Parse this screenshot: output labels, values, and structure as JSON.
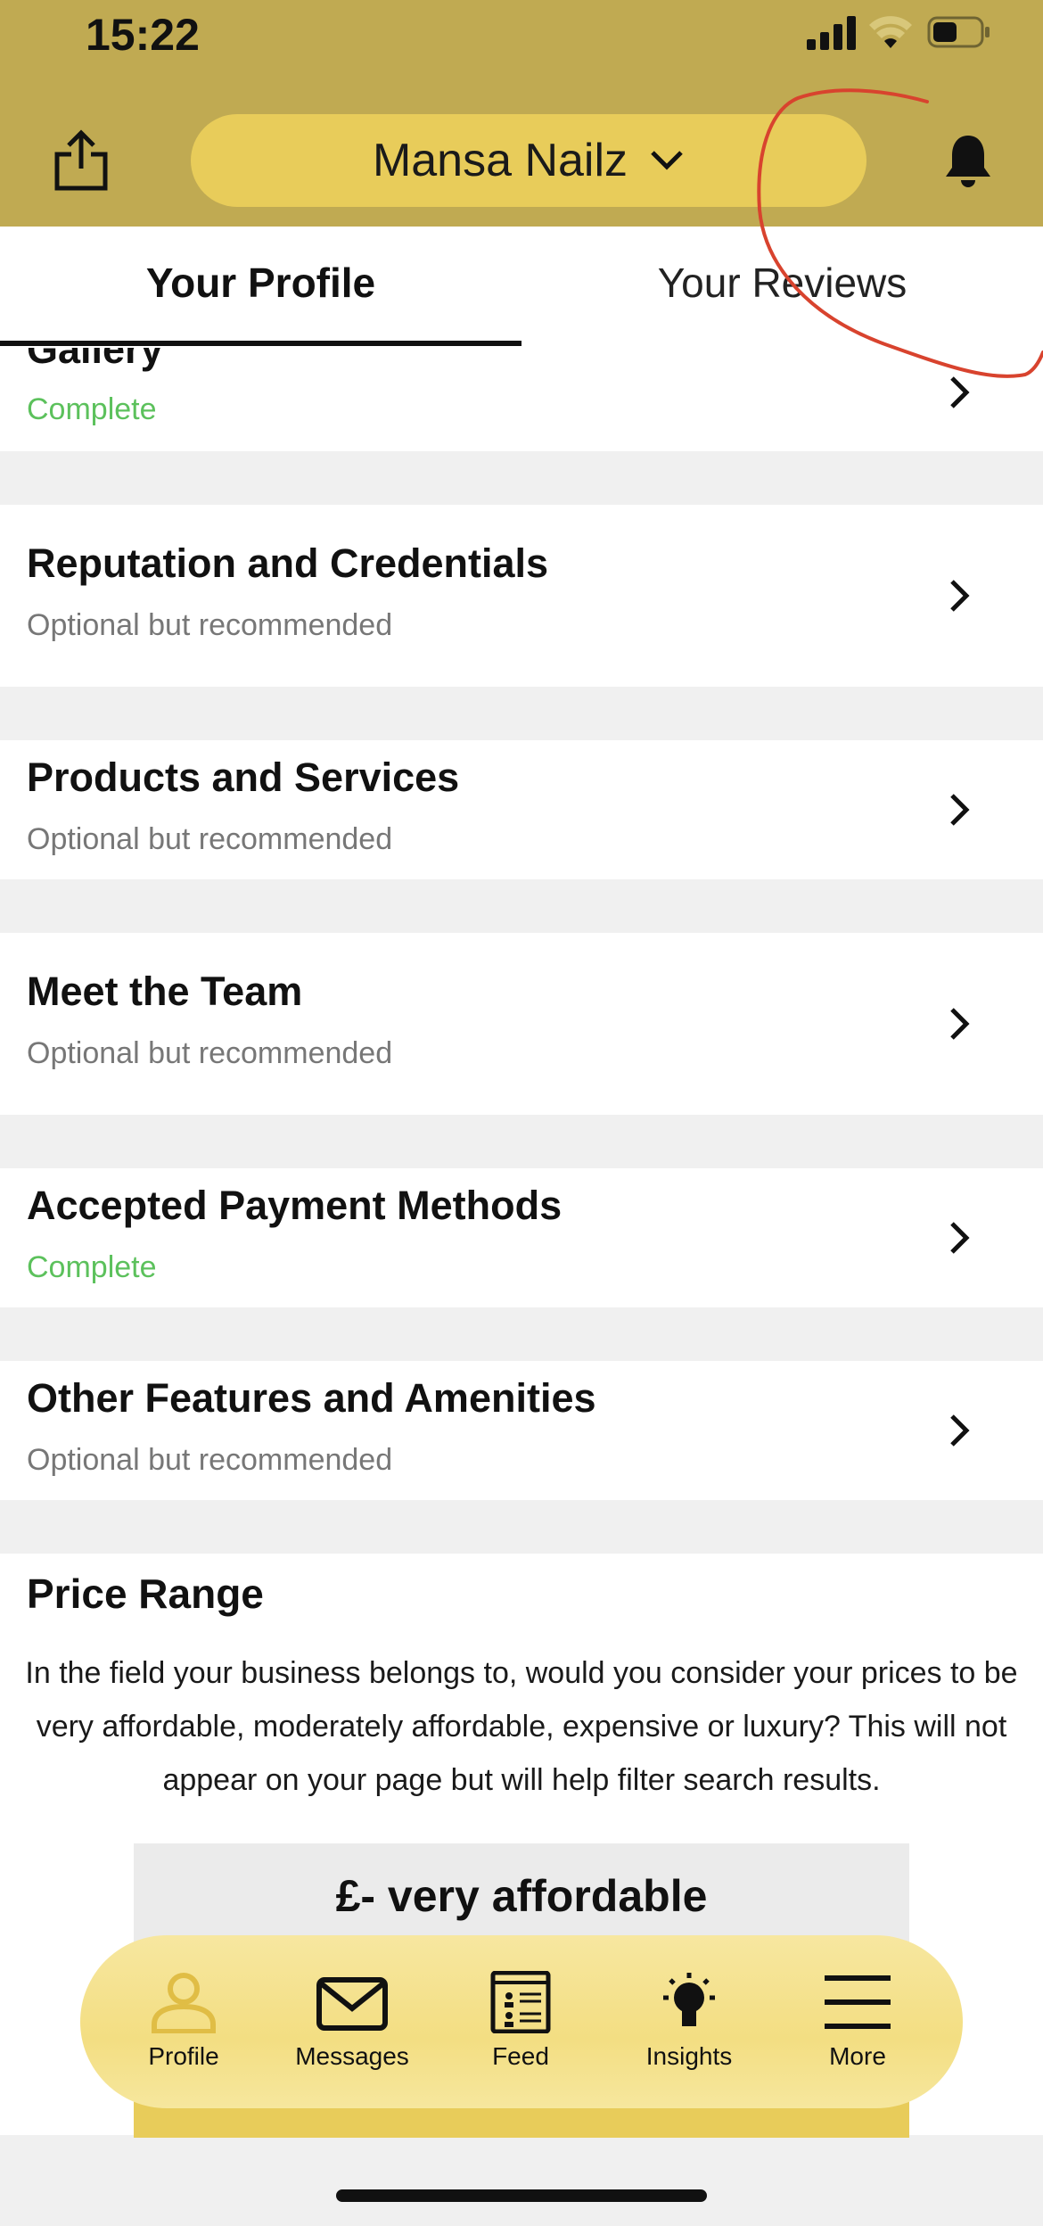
{
  "status_bar": {
    "time": "15:22"
  },
  "header": {
    "account_name": "Mansa Nailz"
  },
  "tabs": [
    {
      "label": "Your Profile",
      "active": true
    },
    {
      "label": "Your Reviews",
      "active": false
    }
  ],
  "sections": [
    {
      "title": "Gallery",
      "status": "Complete"
    },
    {
      "title": "Reputation and Credentials",
      "status": "Optional but recommended"
    },
    {
      "title": "Products and Services",
      "status": "Optional but recommended"
    },
    {
      "title": "Meet the Team",
      "status": "Optional but recommended"
    },
    {
      "title": "Accepted Payment Methods",
      "status": "Complete"
    },
    {
      "title": "Other Features and Amenities",
      "status": "Optional but recommended"
    }
  ],
  "price_range": {
    "title": "Price Range",
    "description": "In the field your business belongs to, would you consider your prices to be very affordable, moderately affordable, expensive or luxury? This will not appear on your page but will help filter search results.",
    "selected_option": "£- very affordable"
  },
  "bottom_nav": [
    {
      "label": "Profile",
      "icon": "profile-icon",
      "active": true
    },
    {
      "label": "Messages",
      "icon": "envelope-icon"
    },
    {
      "label": "Feed",
      "icon": "feed-icon"
    },
    {
      "label": "Insights",
      "icon": "lightbulb-icon"
    },
    {
      "label": "More",
      "icon": "menu-icon"
    }
  ],
  "colors": {
    "header_bg": "#c0aa52",
    "pill_bg": "#e8cc5a",
    "complete_green": "#5cc15c",
    "active_nav_icon": "#e0bd45",
    "annotation_red": "#d8432e"
  }
}
